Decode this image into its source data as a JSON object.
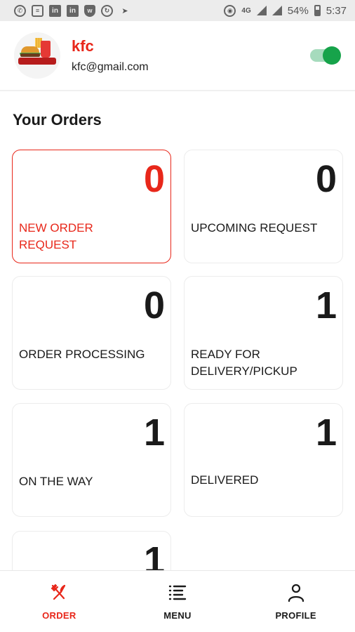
{
  "status_bar": {
    "network": "4G",
    "battery": "54%",
    "time": "5:37"
  },
  "profile": {
    "name": "kfc",
    "email": "kfc@gmail.com",
    "online_toggle": true
  },
  "orders": {
    "title": "Your Orders",
    "cards": [
      {
        "label": "NEW ORDER REQUEST",
        "count": "0",
        "active": true
      },
      {
        "label": "UPCOMING REQUEST",
        "count": "0",
        "active": false
      },
      {
        "label": "ORDER PROCESSING",
        "count": "0",
        "active": false
      },
      {
        "label": "READY FOR DELIVERY/PICKUP",
        "count": "1",
        "active": false
      },
      {
        "label": "ON THE WAY",
        "count": "1",
        "active": false
      },
      {
        "label": "DELIVERED",
        "count": "1",
        "active": false
      },
      {
        "label": "",
        "count": "1",
        "active": false
      }
    ]
  },
  "bottom_nav": {
    "items": [
      {
        "label": "ORDER",
        "icon": "fork-knife-icon",
        "active": true
      },
      {
        "label": "MENU",
        "icon": "menu-list-icon",
        "active": false
      },
      {
        "label": "PROFILE",
        "icon": "user-icon",
        "active": false
      }
    ]
  },
  "colors": {
    "accent": "#e8271a",
    "toggle_on": "#16a34a"
  }
}
